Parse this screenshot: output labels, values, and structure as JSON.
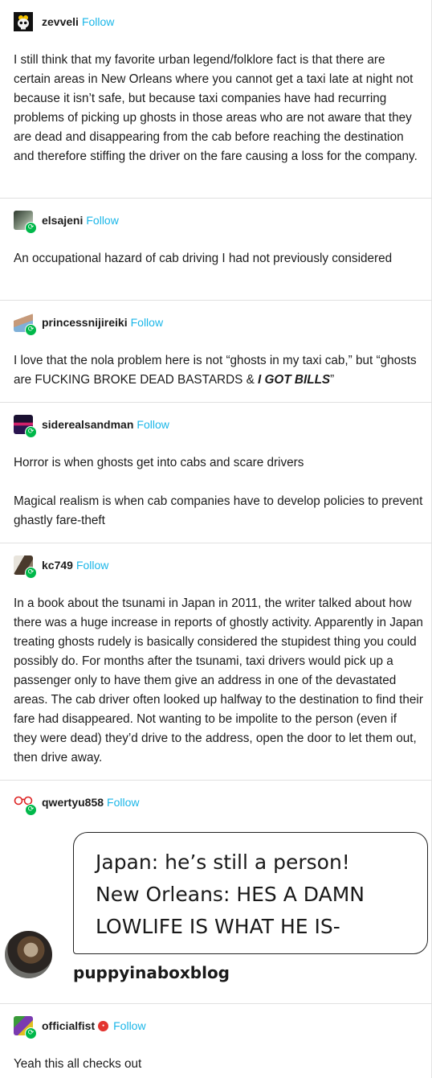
{
  "follow_label": "Follow",
  "colors": {
    "follow": "#1ab6e8",
    "reblog": "#00b84a",
    "divider": "#e0e0e0"
  },
  "posts": [
    {
      "username": "zevveli",
      "avatar_icon": "skull-icon",
      "paragraphs": [
        "I still think that my favorite urban legend/folklore fact is that there are certain areas in New Orleans where you cannot get a taxi late at night not because it isn’t safe, but because taxi companies have had recurring problems of picking up ghosts in those areas who are not aware that they are dead and disappearing from the cab before reaching the destination and therefore stiffing the driver on the fare causing a loss for the company."
      ]
    },
    {
      "username": "elsajeni",
      "avatar_icon": "avatar-image",
      "paragraphs": [
        "An occupational hazard of cab driving I had not previously considered"
      ]
    },
    {
      "username": "princessnijireiki",
      "avatar_icon": "avatar-image",
      "text_before": "I love that the nola problem here is not “ghosts in my taxi cab,” but “ghosts are FUCKING BROKE DEAD BASTARDS & ",
      "text_emph": "I GOT BILLS",
      "text_after": "”"
    },
    {
      "username": "siderealsandman",
      "avatar_icon": "avatar-image",
      "paragraphs": [
        "Horror is when ghosts get into cabs and scare drivers",
        "Magical realism is when cab companies have to develop policies to prevent ghastly fare-theft"
      ]
    },
    {
      "username": "kc749",
      "avatar_icon": "avatar-image",
      "paragraphs": [
        "In a book about the tsunami in Japan in 2011, the writer talked about how there was a huge increase in reports of ghostly activity. Apparently in Japan treating ghosts rudely is basically considered the stupidest thing you could possibly do. For months after the tsunami, taxi drivers would pick up a passenger only to have them give an address in one of the devastated areas. The cab driver often looked up halfway to the destination to find their fare had disappeared. Not wanting to be impolite to the person (even if they were dead) they’d drive to the address, open the door to let them out, then drive away."
      ]
    },
    {
      "username": "qwertyu858",
      "avatar_icon": "glasses-icon",
      "meme": {
        "lines": [
          "Japan: he’s still a person!",
          "New Orleans: HES A DAMN",
          "LOWLIFE IS WHAT HE IS-"
        ],
        "author": "puppyinaboxblog"
      }
    },
    {
      "username": "officialfist",
      "avatar_icon": "avatar-image",
      "badge": "staff",
      "paragraphs": [
        "Yeah this all checks out"
      ]
    }
  ]
}
